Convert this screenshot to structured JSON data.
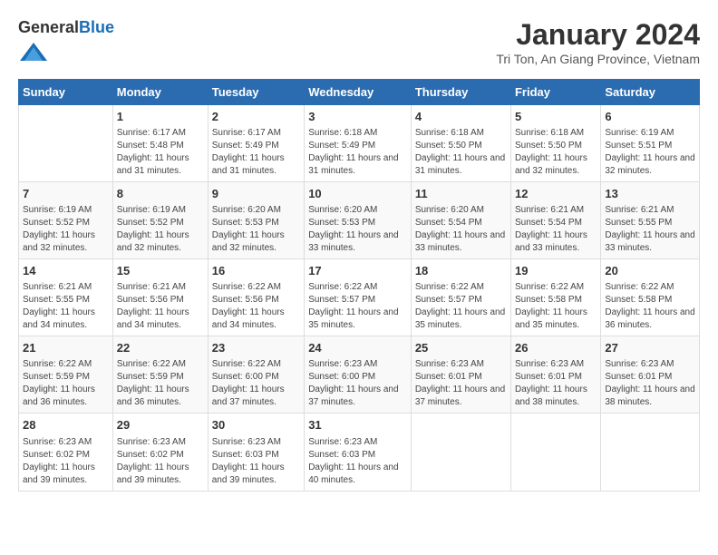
{
  "header": {
    "logo_general": "General",
    "logo_blue": "Blue",
    "title": "January 2024",
    "subtitle": "Tri Ton, An Giang Province, Vietnam"
  },
  "calendar": {
    "days_of_week": [
      "Sunday",
      "Monday",
      "Tuesday",
      "Wednesday",
      "Thursday",
      "Friday",
      "Saturday"
    ],
    "weeks": [
      [
        {
          "day": "",
          "info": ""
        },
        {
          "day": "1",
          "info": "Sunrise: 6:17 AM\nSunset: 5:48 PM\nDaylight: 11 hours and 31 minutes."
        },
        {
          "day": "2",
          "info": "Sunrise: 6:17 AM\nSunset: 5:49 PM\nDaylight: 11 hours and 31 minutes."
        },
        {
          "day": "3",
          "info": "Sunrise: 6:18 AM\nSunset: 5:49 PM\nDaylight: 11 hours and 31 minutes."
        },
        {
          "day": "4",
          "info": "Sunrise: 6:18 AM\nSunset: 5:50 PM\nDaylight: 11 hours and 31 minutes."
        },
        {
          "day": "5",
          "info": "Sunrise: 6:18 AM\nSunset: 5:50 PM\nDaylight: 11 hours and 32 minutes."
        },
        {
          "day": "6",
          "info": "Sunrise: 6:19 AM\nSunset: 5:51 PM\nDaylight: 11 hours and 32 minutes."
        }
      ],
      [
        {
          "day": "7",
          "info": "Sunrise: 6:19 AM\nSunset: 5:52 PM\nDaylight: 11 hours and 32 minutes."
        },
        {
          "day": "8",
          "info": "Sunrise: 6:19 AM\nSunset: 5:52 PM\nDaylight: 11 hours and 32 minutes."
        },
        {
          "day": "9",
          "info": "Sunrise: 6:20 AM\nSunset: 5:53 PM\nDaylight: 11 hours and 32 minutes."
        },
        {
          "day": "10",
          "info": "Sunrise: 6:20 AM\nSunset: 5:53 PM\nDaylight: 11 hours and 33 minutes."
        },
        {
          "day": "11",
          "info": "Sunrise: 6:20 AM\nSunset: 5:54 PM\nDaylight: 11 hours and 33 minutes."
        },
        {
          "day": "12",
          "info": "Sunrise: 6:21 AM\nSunset: 5:54 PM\nDaylight: 11 hours and 33 minutes."
        },
        {
          "day": "13",
          "info": "Sunrise: 6:21 AM\nSunset: 5:55 PM\nDaylight: 11 hours and 33 minutes."
        }
      ],
      [
        {
          "day": "14",
          "info": "Sunrise: 6:21 AM\nSunset: 5:55 PM\nDaylight: 11 hours and 34 minutes."
        },
        {
          "day": "15",
          "info": "Sunrise: 6:21 AM\nSunset: 5:56 PM\nDaylight: 11 hours and 34 minutes."
        },
        {
          "day": "16",
          "info": "Sunrise: 6:22 AM\nSunset: 5:56 PM\nDaylight: 11 hours and 34 minutes."
        },
        {
          "day": "17",
          "info": "Sunrise: 6:22 AM\nSunset: 5:57 PM\nDaylight: 11 hours and 35 minutes."
        },
        {
          "day": "18",
          "info": "Sunrise: 6:22 AM\nSunset: 5:57 PM\nDaylight: 11 hours and 35 minutes."
        },
        {
          "day": "19",
          "info": "Sunrise: 6:22 AM\nSunset: 5:58 PM\nDaylight: 11 hours and 35 minutes."
        },
        {
          "day": "20",
          "info": "Sunrise: 6:22 AM\nSunset: 5:58 PM\nDaylight: 11 hours and 36 minutes."
        }
      ],
      [
        {
          "day": "21",
          "info": "Sunrise: 6:22 AM\nSunset: 5:59 PM\nDaylight: 11 hours and 36 minutes."
        },
        {
          "day": "22",
          "info": "Sunrise: 6:22 AM\nSunset: 5:59 PM\nDaylight: 11 hours and 36 minutes."
        },
        {
          "day": "23",
          "info": "Sunrise: 6:22 AM\nSunset: 6:00 PM\nDaylight: 11 hours and 37 minutes."
        },
        {
          "day": "24",
          "info": "Sunrise: 6:23 AM\nSunset: 6:00 PM\nDaylight: 11 hours and 37 minutes."
        },
        {
          "day": "25",
          "info": "Sunrise: 6:23 AM\nSunset: 6:01 PM\nDaylight: 11 hours and 37 minutes."
        },
        {
          "day": "26",
          "info": "Sunrise: 6:23 AM\nSunset: 6:01 PM\nDaylight: 11 hours and 38 minutes."
        },
        {
          "day": "27",
          "info": "Sunrise: 6:23 AM\nSunset: 6:01 PM\nDaylight: 11 hours and 38 minutes."
        }
      ],
      [
        {
          "day": "28",
          "info": "Sunrise: 6:23 AM\nSunset: 6:02 PM\nDaylight: 11 hours and 39 minutes."
        },
        {
          "day": "29",
          "info": "Sunrise: 6:23 AM\nSunset: 6:02 PM\nDaylight: 11 hours and 39 minutes."
        },
        {
          "day": "30",
          "info": "Sunrise: 6:23 AM\nSunset: 6:03 PM\nDaylight: 11 hours and 39 minutes."
        },
        {
          "day": "31",
          "info": "Sunrise: 6:23 AM\nSunset: 6:03 PM\nDaylight: 11 hours and 40 minutes."
        },
        {
          "day": "",
          "info": ""
        },
        {
          "day": "",
          "info": ""
        },
        {
          "day": "",
          "info": ""
        }
      ]
    ]
  }
}
